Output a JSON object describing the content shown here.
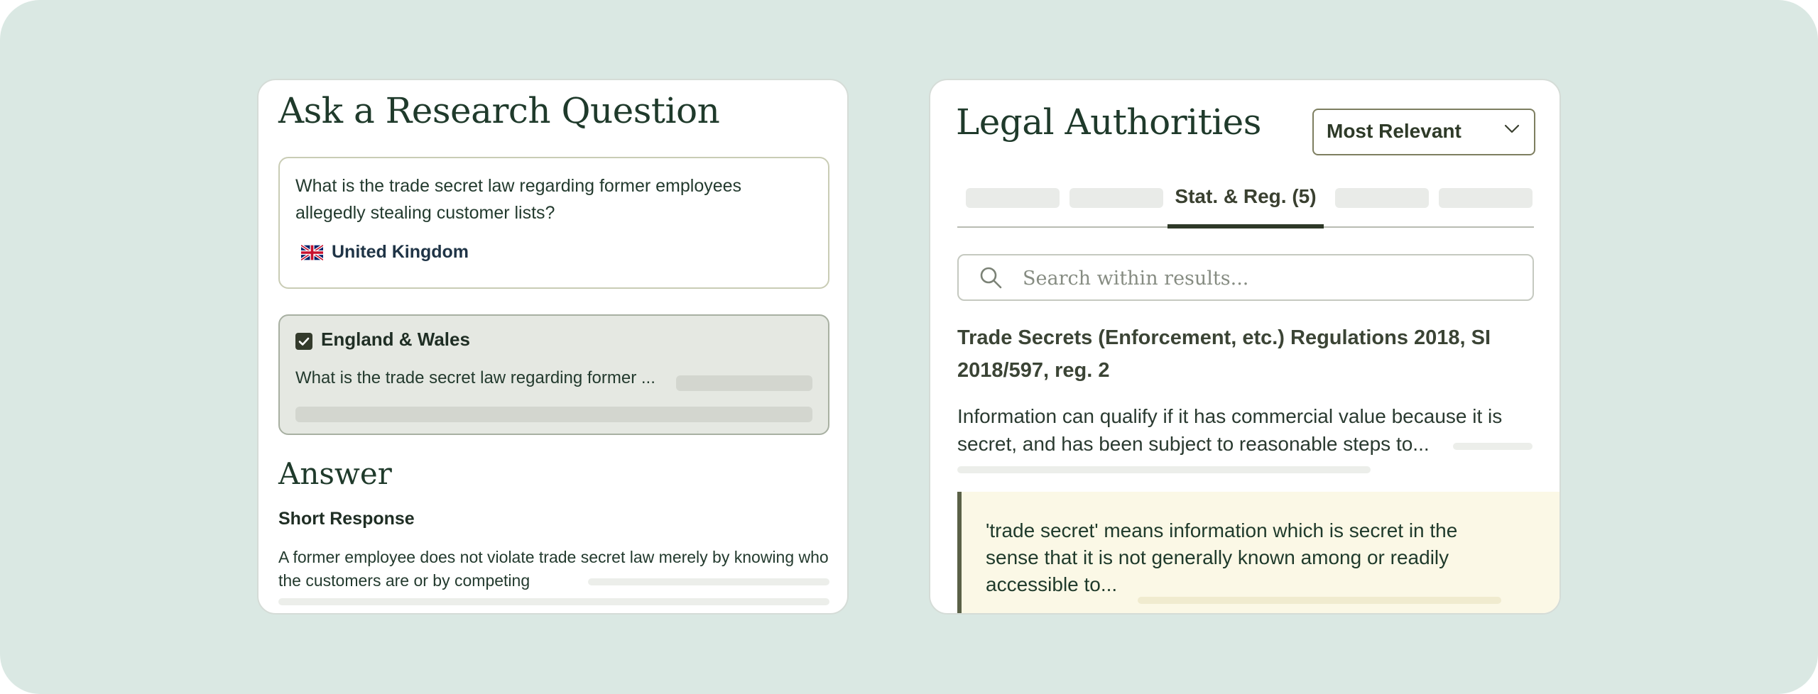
{
  "left_panel": {
    "title": "Ask a Research Question",
    "question": {
      "text": "What is the trade secret law regarding former employees allegedly stealing customer lists?",
      "jurisdiction": "United Kingdom",
      "flag_icon": "uk-flag-icon"
    },
    "selected_jurisdiction": {
      "title": "England & Wales",
      "checked": true,
      "preview": "What is the trade secret law regarding former ..."
    },
    "answer": {
      "heading": "Answer",
      "subheading": "Short Response",
      "text": "A former employee does not violate trade secret law merely by knowing who the customers are or by competing"
    }
  },
  "right_panel": {
    "title": "Legal Authorities",
    "sort": {
      "selected": "Most Relevant",
      "icon": "chevron-down-icon"
    },
    "tabs": {
      "active_label": "Stat. & Reg. (5)"
    },
    "search": {
      "placeholder": "Search within results...",
      "icon": "search-icon"
    },
    "result": {
      "title": "Trade Secrets (Enforcement, etc.) Regulations 2018, SI 2018/597, reg. 2",
      "snippet": "Information can qualify if it has commercial value because it is secret, and has been subject to reasonable steps to...",
      "quote": "'trade secret' means information which is secret in the sense that it is not generally known among or readily accessible to..."
    }
  },
  "colors": {
    "background": "#dae8e3",
    "heading": "#1f3a2b",
    "selected_box": "#e5e8e2",
    "quote_background": "#fbf8e6",
    "accent_dark": "#2e3827"
  }
}
